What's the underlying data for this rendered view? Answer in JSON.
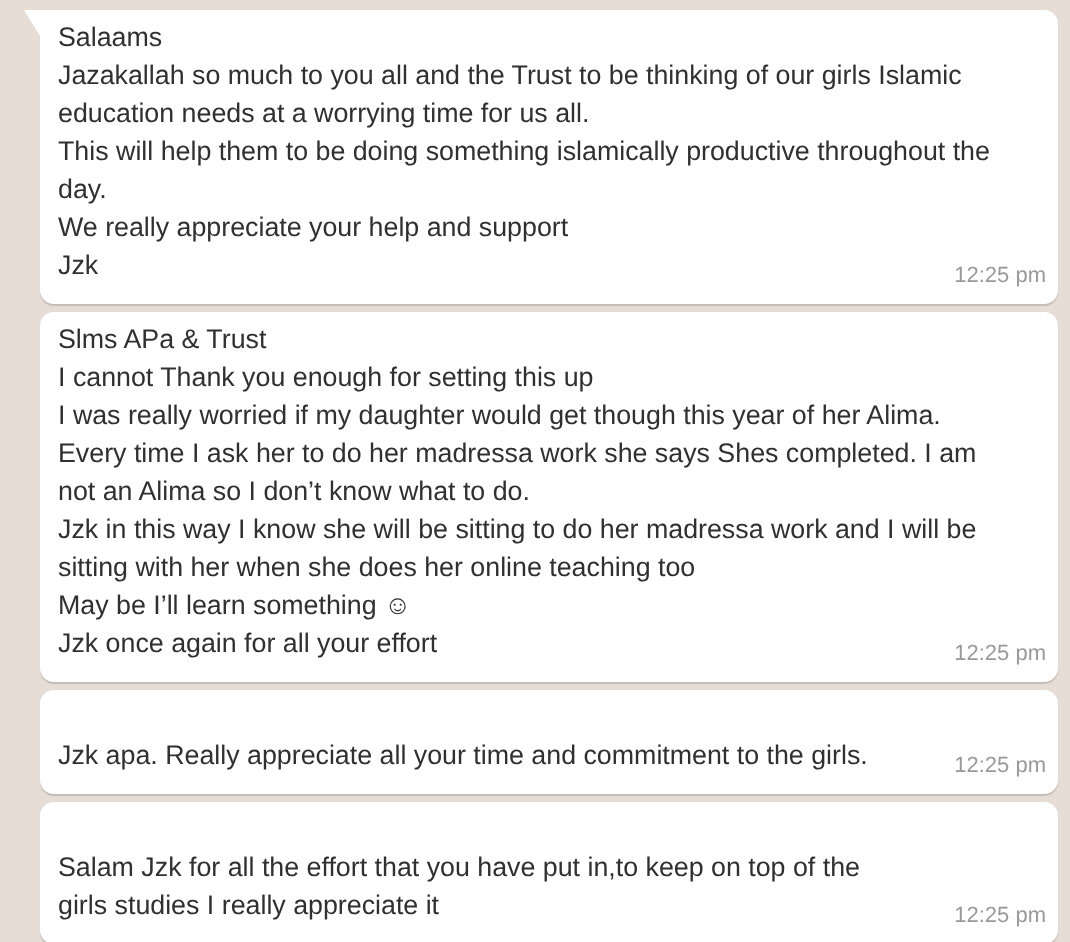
{
  "messages": [
    {
      "tail": true,
      "leading_blank": false,
      "paragraphs": [
        "Salaams",
        "Jazakallah so much to you all and the Trust to be thinking of our girls Islamic education needs at a worrying time for us all.",
        "This will help them to be doing something islamically productive throughout the day.",
        "We really appreciate your help and support",
        "Jzk"
      ],
      "time": "12:25 pm"
    },
    {
      "tail": false,
      "leading_blank": false,
      "paragraphs": [
        "Slms APa & Trust",
        "I cannot Thank you enough for setting this up",
        "I was really worried if my daughter would get though this year of her Alima.",
        "Every time I ask her to do her madressa work she says Shes completed. I am not an Alima so I don’t know what to do.",
        "Jzk in this way I know she will be sitting to do her madressa work and I will be sitting with her when she does her online teaching too",
        "May be I’ll learn something ☺",
        "Jzk once again for all your effort"
      ],
      "time": "12:25 pm"
    },
    {
      "tail": false,
      "leading_blank": true,
      "paragraphs": [
        "Jzk apa. Really appreciate all your time and commitment to the girls."
      ],
      "time": "12:25 pm"
    },
    {
      "tail": false,
      "leading_blank": true,
      "paragraphs": [
        "Salam Jzk for all the effort that you have put in,to keep on top of the girls studies I really appreciate it"
      ],
      "time": "12:25 pm"
    }
  ]
}
